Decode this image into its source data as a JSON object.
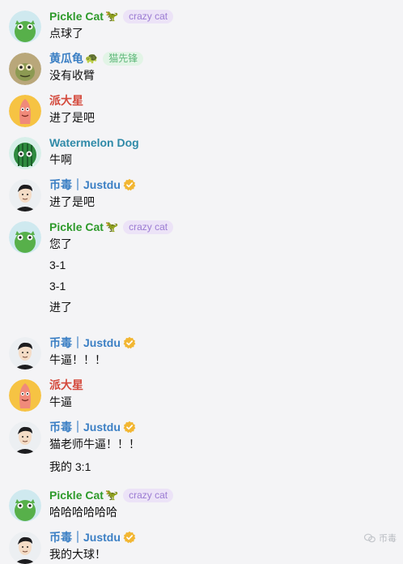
{
  "messages": [
    {
      "sender": "Pickle Cat",
      "color": "green",
      "avatar": "pickle-cat",
      "emoji": "🦖",
      "tag": "crazy cat",
      "tag_style": "purple",
      "verified": false,
      "lines": [
        "点球了"
      ]
    },
    {
      "sender": "黄瓜龟",
      "color": "blue",
      "avatar": "turtle",
      "emoji": "🐢",
      "tag": "猫先锋",
      "tag_style": "green",
      "verified": false,
      "lines": [
        "没有收臂"
      ]
    },
    {
      "sender": "派大星",
      "color": "red",
      "avatar": "starfish",
      "emoji": "",
      "tag": "",
      "tag_style": "",
      "verified": false,
      "lines": [
        "进了是吧"
      ]
    },
    {
      "sender": "Watermelon Dog",
      "color": "teal",
      "avatar": "watermelon",
      "emoji": "",
      "tag": "",
      "tag_style": "",
      "verified": false,
      "lines": [
        "牛啊"
      ]
    },
    {
      "sender": "币毒｜Justdu",
      "color": "blue",
      "avatar": "man",
      "emoji": "",
      "tag": "",
      "tag_style": "",
      "verified": true,
      "lines": [
        "进了是吧"
      ]
    },
    {
      "sender": "Pickle Cat",
      "color": "green",
      "avatar": "pickle-cat",
      "emoji": "🦖",
      "tag": "crazy cat",
      "tag_style": "purple",
      "verified": false,
      "lines": [
        "您了",
        "3-1",
        "3-1",
        "进了"
      ]
    },
    {
      "sender": "币毒｜Justdu",
      "color": "blue",
      "avatar": "man",
      "emoji": "",
      "tag": "",
      "tag_style": "",
      "verified": true,
      "lines": [
        "牛逼！！！"
      ]
    },
    {
      "sender": "派大星",
      "color": "red",
      "avatar": "starfish",
      "emoji": "",
      "tag": "",
      "tag_style": "",
      "verified": false,
      "lines": [
        "牛逼"
      ]
    },
    {
      "sender": "币毒｜Justdu",
      "color": "blue",
      "avatar": "man",
      "emoji": "",
      "tag": "",
      "tag_style": "",
      "verified": true,
      "lines": [
        "猫老师牛逼！！！",
        "我的 3:1"
      ]
    },
    {
      "sender": "Pickle Cat",
      "color": "green",
      "avatar": "pickle-cat",
      "emoji": "🦖",
      "tag": "crazy cat",
      "tag_style": "purple",
      "verified": false,
      "lines": [
        "哈哈哈哈哈哈"
      ]
    },
    {
      "sender": "币毒｜Justdu",
      "color": "blue",
      "avatar": "man",
      "emoji": "",
      "tag": "",
      "tag_style": "",
      "verified": true,
      "lines": [
        "我的大球！"
      ]
    }
  ],
  "watermark": {
    "text": "币毒",
    "icon": "wechat-logo-icon"
  }
}
